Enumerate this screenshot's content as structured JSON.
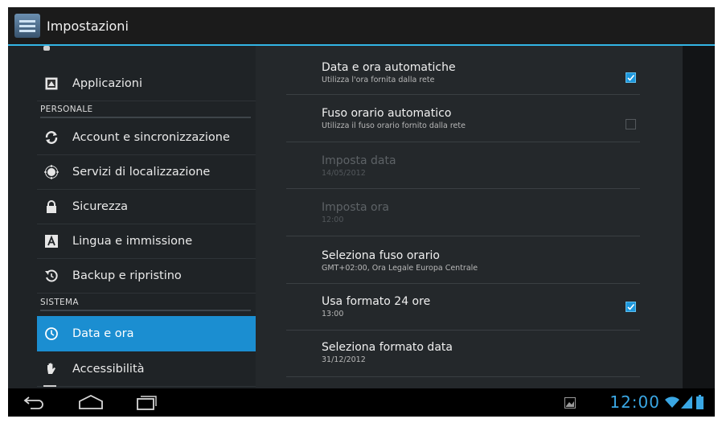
{
  "action_bar": {
    "title": "Impostazioni"
  },
  "sidebar": {
    "items": [
      {
        "label": "Applicazioni",
        "icon": "apps-icon"
      },
      {
        "label": "Account e sincronizzazione",
        "icon": "sync-icon"
      },
      {
        "label": "Servizi di localizzazione",
        "icon": "location-icon"
      },
      {
        "label": "Sicurezza",
        "icon": "lock-icon"
      },
      {
        "label": "Lingua e immissione",
        "icon": "keyboard-icon"
      },
      {
        "label": "Backup e ripristino",
        "icon": "backup-icon"
      },
      {
        "label": "Data e ora",
        "icon": "clock-icon",
        "selected": true
      },
      {
        "label": "Accessibilità",
        "icon": "hand-icon"
      }
    ],
    "headers": {
      "personale": "PERSONALE",
      "sistema": "SISTEMA"
    }
  },
  "settings": [
    {
      "title": "Data e ora automatiche",
      "summary": "Utilizza l'ora fornita dalla rete",
      "checked": true
    },
    {
      "title": "Fuso orario automatico",
      "summary": "Utilizza il fuso orario fornito dalla rete",
      "checked": false
    },
    {
      "title": "Imposta data",
      "summary": "14/05/2012",
      "disabled": true
    },
    {
      "title": "Imposta ora",
      "summary": "12:00",
      "disabled": true
    },
    {
      "title": "Seleziona fuso orario",
      "summary": "GMT+02:00, Ora Legale Europa Centrale"
    },
    {
      "title": "Usa formato 24 ore",
      "summary": "13:00",
      "checked": true
    },
    {
      "title": "Seleziona formato data",
      "summary": "31/12/2012"
    }
  ],
  "status": {
    "time": "12:00"
  },
  "colors": {
    "accent": "#33b5e5",
    "selected": "#1b8ed1"
  }
}
